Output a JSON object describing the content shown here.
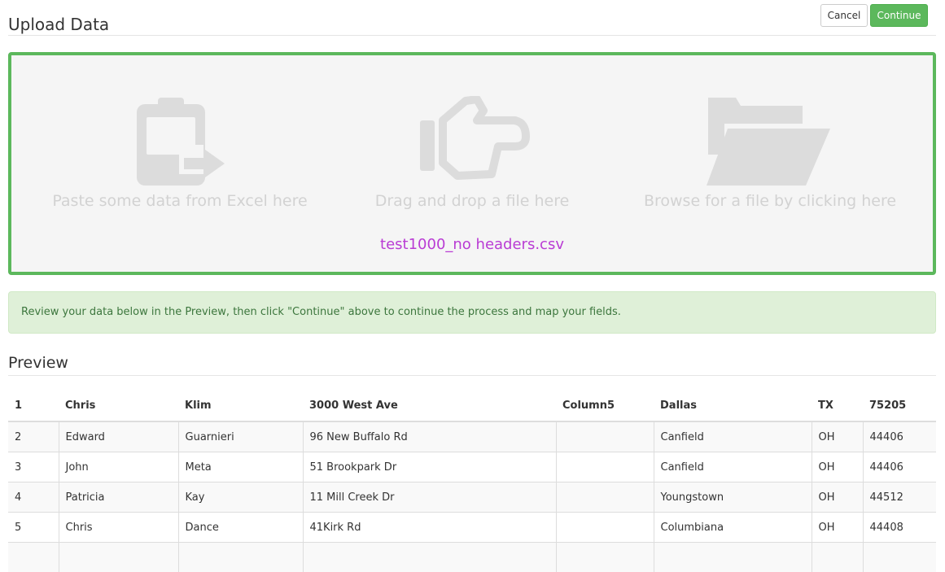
{
  "header": {
    "title": "Upload Data",
    "cancel_label": "Cancel",
    "continue_label": "Continue"
  },
  "dropzone": {
    "paste_label": "Paste some data from Excel here",
    "drag_label": "Drag and drop a file here",
    "browse_label": "Browse for a file by clicking here",
    "filename": "test1000_no headers.csv",
    "icons": [
      "clipboard-paste-icon",
      "hand-pointer-icon",
      "folder-open-icon"
    ]
  },
  "alert": {
    "message": "Review your data below in the Preview, then click \"Continue\" above to continue the process and map your fields."
  },
  "preview": {
    "title": "Preview",
    "columns": [
      "1",
      "Chris",
      "Klim",
      "3000 West Ave",
      "Column5",
      "Dallas",
      "TX",
      "75205"
    ],
    "rows": [
      [
        "2",
        "Edward",
        "Guarnieri",
        "96 New Buffalo Rd",
        "",
        "Canfield",
        "OH",
        "44406"
      ],
      [
        "3",
        "John",
        "Meta",
        "51 Brookpark Dr",
        "",
        "Canfield",
        "OH",
        "44406"
      ],
      [
        "4",
        "Patricia",
        "Kay",
        "11 Mill Creek Dr",
        "",
        "Youngstown",
        "OH",
        "44512"
      ],
      [
        "5",
        "Chris",
        "Dance",
        "41Kirk Rd",
        "",
        "Columbiana",
        "OH",
        "44408"
      ],
      [
        "",
        "",
        "",
        "",
        "",
        "",
        "",
        ""
      ]
    ]
  },
  "colors": {
    "accent": "#5cb85c",
    "filename": "#b93cd4",
    "alert_bg": "#dff0d8",
    "alert_text": "#3c763d"
  }
}
